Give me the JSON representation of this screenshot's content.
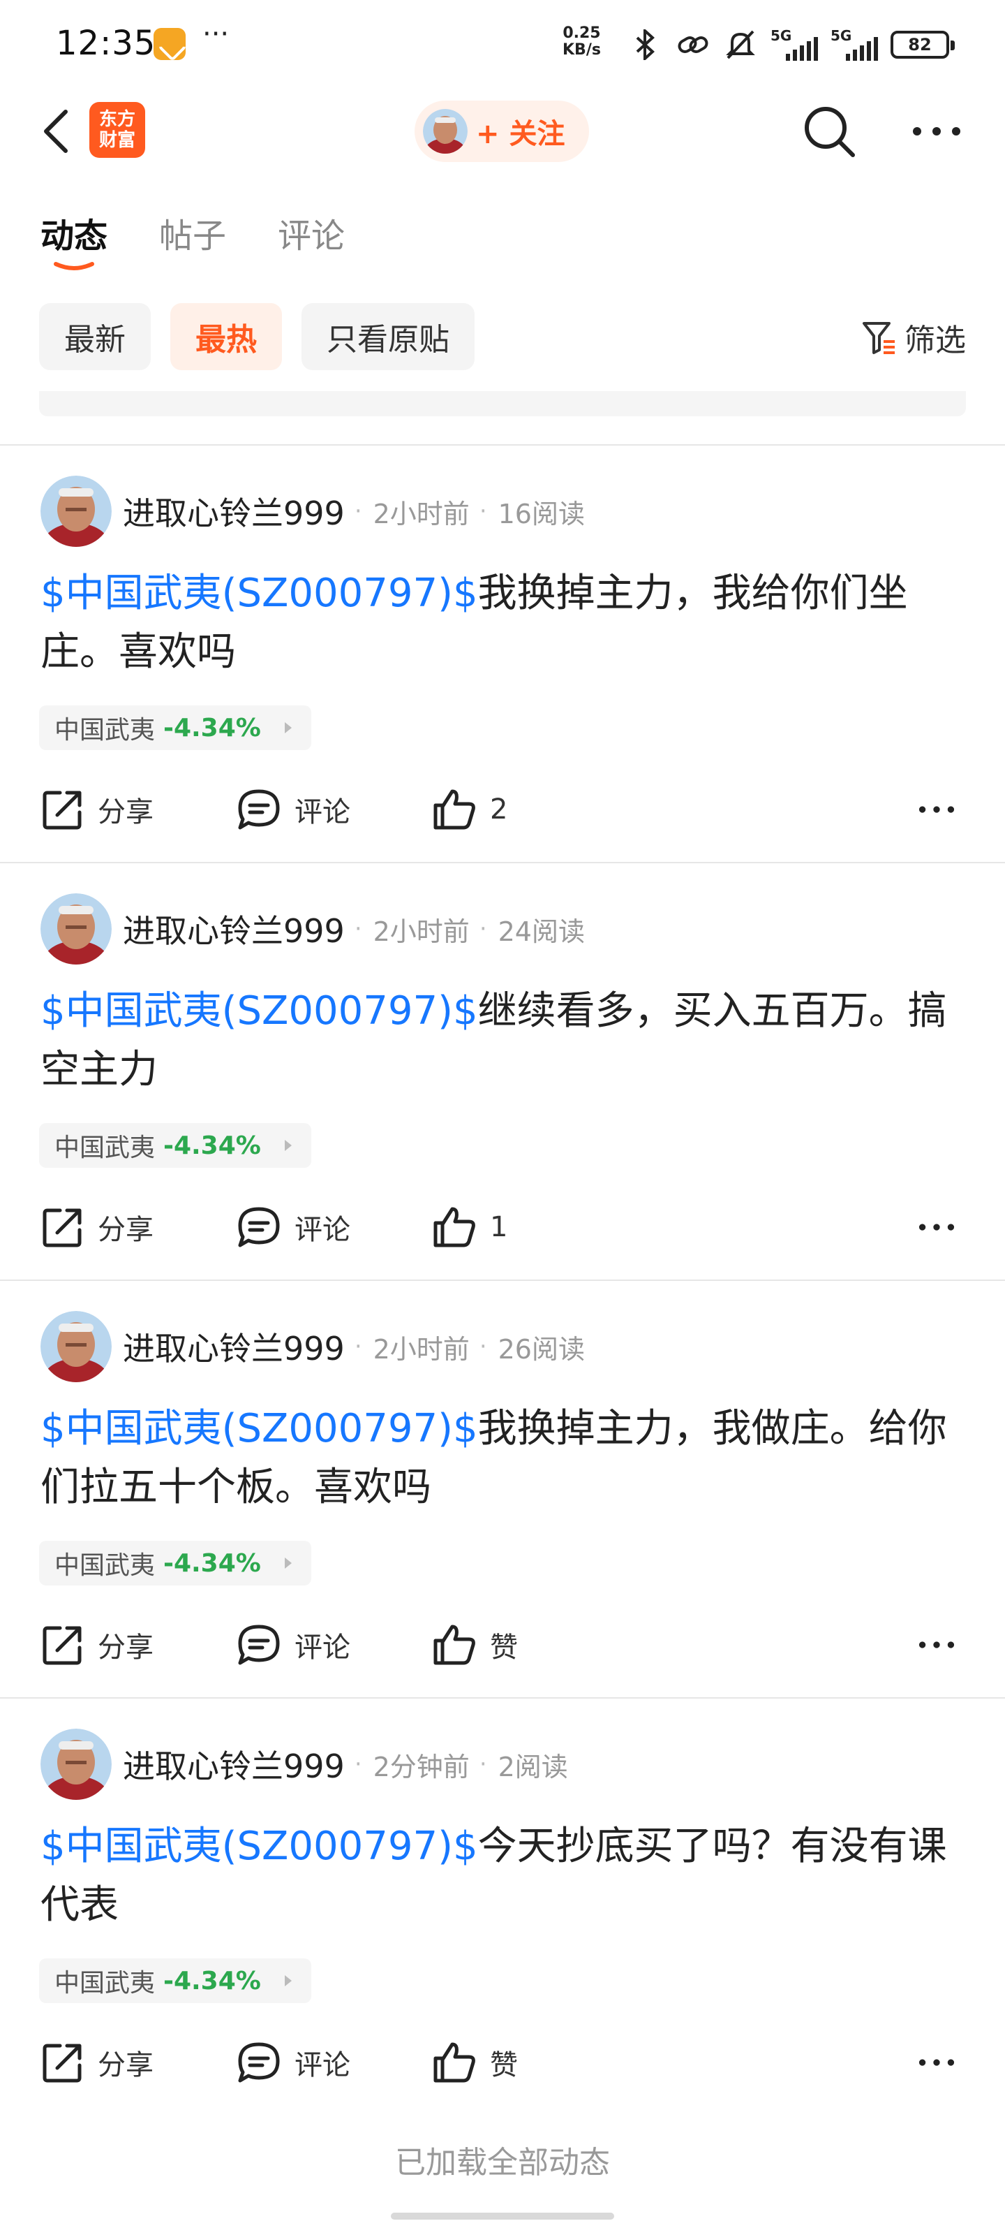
{
  "status_bar": {
    "time": "12:35",
    "more": "···",
    "net_speed_value": "0.25",
    "net_speed_unit": "KB/s",
    "sig1_label": "5G",
    "sig2_label": "5G",
    "battery": "82"
  },
  "nav": {
    "logo_text": "东方\n财富",
    "follow_label": "+ 关注"
  },
  "tabs": [
    {
      "label": "动态",
      "active": true
    },
    {
      "label": "帖子",
      "active": false
    },
    {
      "label": "评论",
      "active": false
    }
  ],
  "filters": {
    "chips": [
      {
        "label": "最新",
        "active": false
      },
      {
        "label": "最热",
        "active": true
      },
      {
        "label": "只看原贴",
        "active": false
      }
    ],
    "filter_label": "筛选"
  },
  "posts": [
    {
      "author": "进取心铃兰999",
      "time": "2小时前",
      "reads": "16阅读",
      "tag": "$中国武夷(SZ000797)$",
      "text": "我换掉主力，我给你们坐庄。喜欢吗",
      "stock_name": "中国武夷",
      "stock_change": "-4.34%",
      "share": "分享",
      "comment": "评论",
      "like": "2"
    },
    {
      "author": "进取心铃兰999",
      "time": "2小时前",
      "reads": "24阅读",
      "tag": "$中国武夷(SZ000797)$",
      "text": "继续看多，买入五百万。搞空主力",
      "stock_name": "中国武夷",
      "stock_change": "-4.34%",
      "share": "分享",
      "comment": "评论",
      "like": "1"
    },
    {
      "author": "进取心铃兰999",
      "time": "2小时前",
      "reads": "26阅读",
      "tag": "$中国武夷(SZ000797)$",
      "text": "我换掉主力，我做庄。给你们拉五十个板。喜欢吗",
      "stock_name": "中国武夷",
      "stock_change": "-4.34%",
      "share": "分享",
      "comment": "评论",
      "like": "赞"
    },
    {
      "author": "进取心铃兰999",
      "time": "2分钟前",
      "reads": "2阅读",
      "tag": "$中国武夷(SZ000797)$",
      "text": "今天抄底买了吗？有没有课代表",
      "stock_name": "中国武夷",
      "stock_change": "-4.34%",
      "share": "分享",
      "comment": "评论",
      "like": "赞"
    }
  ],
  "footer": {
    "note": "已加载全部动态"
  },
  "colors": {
    "accent": "#ff5a1f",
    "link": "#1677ff",
    "down": "#2ca84e"
  }
}
